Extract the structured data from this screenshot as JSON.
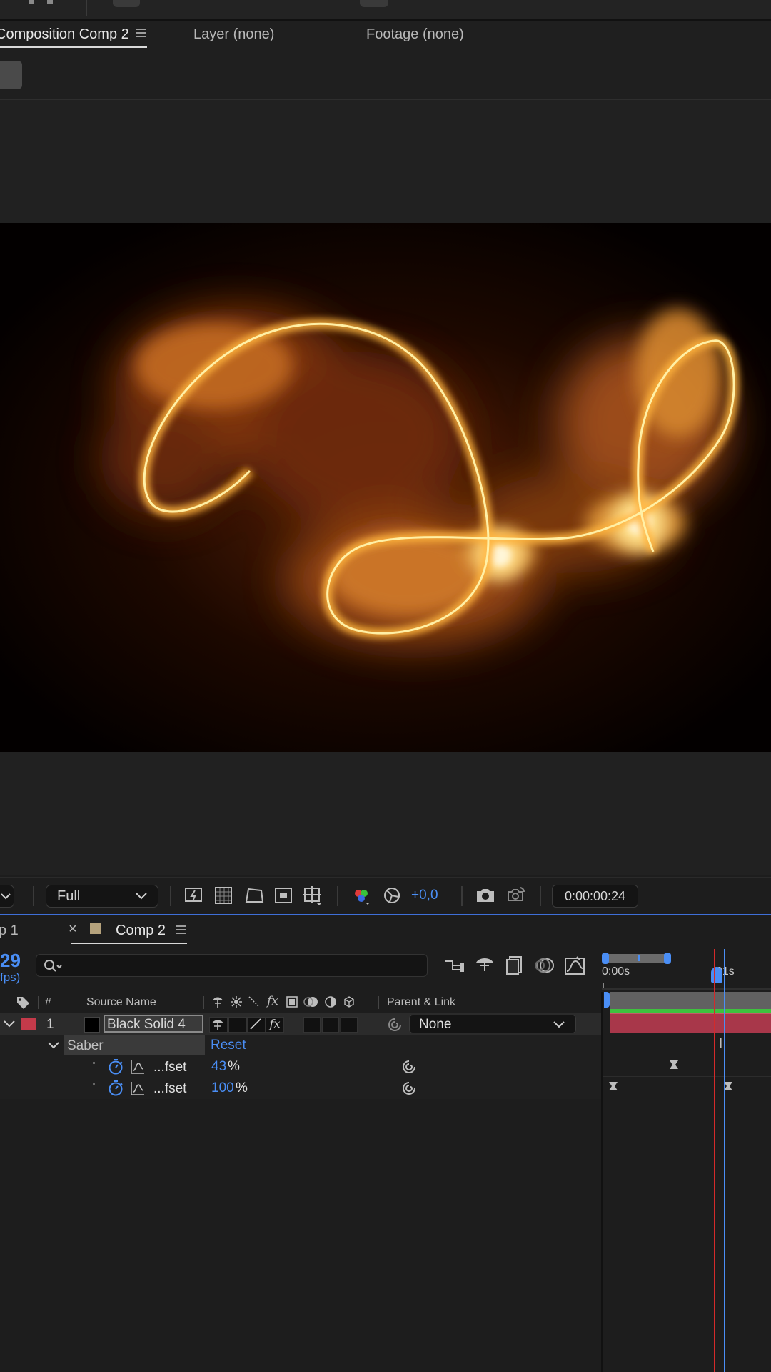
{
  "viewer_tabs": {
    "composition_label": "Composition Comp 2",
    "layer_label": "Layer (none)",
    "footage_label": "Footage (none)"
  },
  "viewer_footer": {
    "resolution": "Full",
    "exposure": "+0,0",
    "current_time": "0:00:00:24"
  },
  "timeline_tabs": {
    "prev_tab_label": "p 1",
    "active_tab_label": "Comp 2",
    "active_tab_color": "#b5a27c"
  },
  "timeline_header": {
    "frame_number": "29",
    "fps_label": "fps)",
    "ruler_start": "0:00s",
    "ruler_marker": "01s"
  },
  "columns": {
    "number": "#",
    "source_name": "Source Name",
    "parent_link": "Parent & Link"
  },
  "layer": {
    "index": "1",
    "label_color": "#c43a4a",
    "name": "Black Solid 4",
    "parent": "None"
  },
  "effect": {
    "name": "Saber",
    "reset_label": "Reset"
  },
  "properties": [
    {
      "name": "...fset",
      "value": "43",
      "unit": "%"
    },
    {
      "name": "...fset",
      "value": "100",
      "unit": "%"
    }
  ],
  "colors": {
    "accent_blue": "#4a8ef5",
    "playhead_red": "#d42a2a",
    "layer_bar": "#a8374a",
    "work_area_green": "#3ec23e"
  }
}
